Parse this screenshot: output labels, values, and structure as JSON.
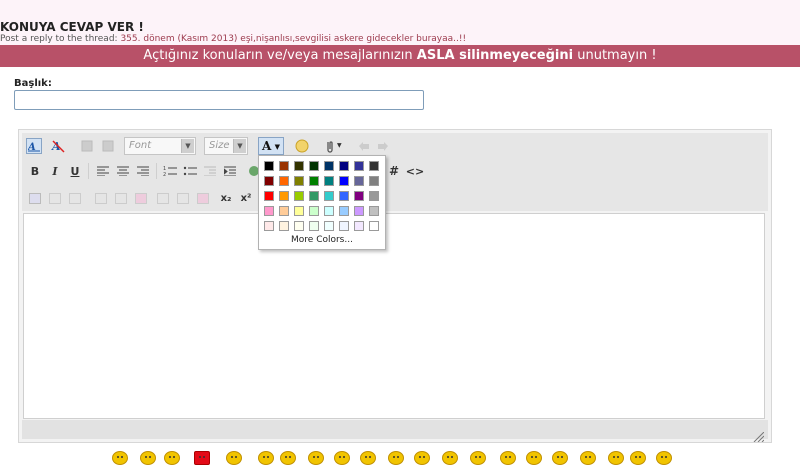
{
  "page": {
    "title": "KONUYA CEVAP VER !",
    "subline_prefix": "Post a reply to the thread:",
    "thread_title": "355. dönem (Kasım 2013) eşi,nişanlısı,sevgilisi askere gidecekler burayaa..!!"
  },
  "banner": {
    "part1": "Açtığınız konuların ve/veya mesajlarınızın",
    "bold": "ASLA silinmeyeceğini",
    "part2": "unutmayın !"
  },
  "form": {
    "title_label": "Başlık:",
    "title_value": ""
  },
  "toolbar": {
    "font_placeholder": "Font",
    "size_placeholder": "Size",
    "font_color_label": "A",
    "bold": "B",
    "italic": "I",
    "underline": "U",
    "hash": "#",
    "code": "<>",
    "subscript": "x₂",
    "superscript": "x²"
  },
  "color_picker": {
    "more_colors": "More Colors...",
    "rows": [
      [
        "#000000",
        "#993300",
        "#333300",
        "#003300",
        "#003366",
        "#000080",
        "#333399",
        "#333333"
      ],
      [
        "#800000",
        "#FF6600",
        "#808000",
        "#008000",
        "#008080",
        "#0000FF",
        "#666699",
        "#808080"
      ],
      [
        "#FF0000",
        "#FF9900",
        "#99CC00",
        "#339966",
        "#33CCCC",
        "#3366FF",
        "#800080",
        "#999999"
      ],
      [
        "#FF99CC",
        "#FFCC99",
        "#FFFF99",
        "#CCFFCC",
        "#CCFFFF",
        "#99CCFF",
        "#CC99FF",
        "#C0C0C0"
      ],
      [
        "#FFE9E9",
        "#FFF3E0",
        "#FFFFF0",
        "#F0FFF0",
        "#F0FFFF",
        "#F0F5FF",
        "#F3E8FF",
        "#FFFFFF"
      ]
    ]
  },
  "colors": {
    "banner": "#b85168",
    "page_bg": "#fdf3f9"
  },
  "smileys": [
    "smiley-1",
    "smiley-2",
    "smiley-3",
    "flag-tr",
    "smiley-5",
    "smiley-6",
    "smiley-7",
    "smiley-8",
    "smiley-9",
    "smiley-10",
    "smiley-11",
    "smiley-12",
    "smiley-13",
    "smiley-14",
    "smiley-15",
    "smiley-16",
    "smiley-17",
    "smiley-18",
    "smiley-19",
    "smiley-20",
    "smiley-21"
  ]
}
